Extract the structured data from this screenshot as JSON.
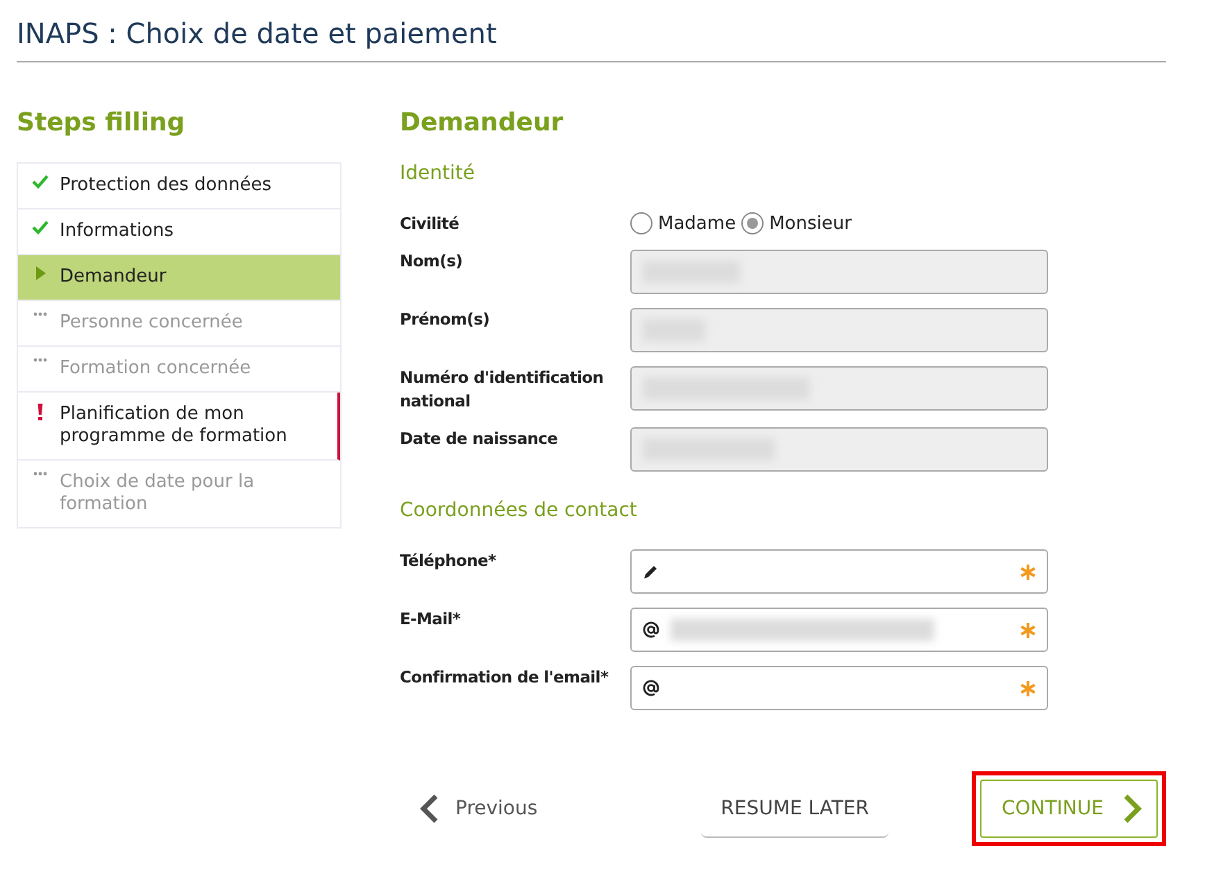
{
  "page_title": "INAPS : Choix de date et paiement",
  "sidebar": {
    "title": "Steps filling",
    "steps": [
      {
        "label": "Protection des données",
        "kind": "done",
        "selected": false
      },
      {
        "label": "Informations",
        "kind": "done",
        "selected": false
      },
      {
        "label": "Demandeur",
        "kind": "current",
        "selected": true
      },
      {
        "label": "Personne concernée",
        "kind": "pending",
        "selected": false
      },
      {
        "label": "Formation concernée",
        "kind": "pending",
        "selected": false
      },
      {
        "label": "Planification de mon programme de formation",
        "kind": "error",
        "selected": false
      },
      {
        "label": "Choix de date pour la formation",
        "kind": "pending",
        "selected": false
      }
    ]
  },
  "form": {
    "title": "Demandeur",
    "sections": [
      {
        "title": "Identité",
        "rows": [
          {
            "kind": "radio",
            "label": "Civilité",
            "options": [
              {
                "label": "Madame",
                "selected": false
              },
              {
                "label": "Monsieur",
                "selected": true
              }
            ]
          },
          {
            "kind": "readonly",
            "label": "Nom(s)",
            "redacted": true
          },
          {
            "kind": "readonly",
            "label": "Prénom(s)",
            "redacted": true
          },
          {
            "kind": "readonly",
            "label": "Numéro d'identification national",
            "redacted": true
          },
          {
            "kind": "readonly",
            "label": "Date de naissance",
            "redacted": true
          }
        ]
      },
      {
        "title": "Coordonnées de contact",
        "rows": [
          {
            "kind": "phone",
            "label": "Téléphone*",
            "required": true,
            "redacted": false
          },
          {
            "kind": "email",
            "label": "E-Mail*",
            "required": true,
            "redacted": true
          },
          {
            "kind": "email",
            "label": "Confirmation de l'email*",
            "required": true,
            "redacted": false
          }
        ]
      }
    ]
  },
  "buttons": {
    "previous": "Previous",
    "resume": "RESUME LATER",
    "continue": {
      "label": "CONTINUE",
      "highlighted": true
    }
  }
}
